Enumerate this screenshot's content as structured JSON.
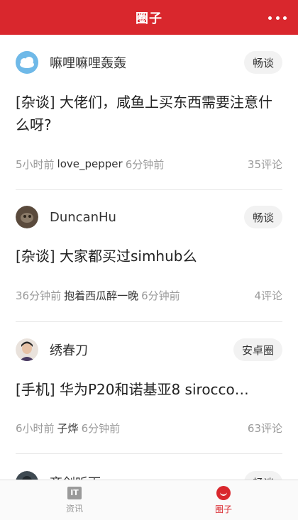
{
  "header": {
    "title": "圈子",
    "more_icon": "more-icon"
  },
  "posts": [
    {
      "author": "嘛哩嘛哩轰轰",
      "tag": "畅谈",
      "title": "[杂谈] 大佬们，咸鱼上买东西需要注意什么呀?",
      "posted": "5小时前",
      "replier": "love_pepper",
      "replied": "6分钟前",
      "comments": "35评论"
    },
    {
      "author": "DuncanHu",
      "tag": "畅谈",
      "title": "[杂谈] 大家都买过simhub么",
      "posted": "36分钟前",
      "replier": "抱着西瓜醉一晚",
      "replied": "6分钟前",
      "comments": "4评论"
    },
    {
      "author": "绣春刀",
      "tag": "安卓圈",
      "title": "[手机] 华为P20和诺基亚8 sirocco…",
      "posted": "6小时前",
      "replier": "子烨",
      "replied": "6分钟前",
      "comments": "63评论"
    },
    {
      "author": "齐剑听雨",
      "tag": "畅谈"
    }
  ],
  "tabbar": {
    "tabs": [
      {
        "label": "资讯",
        "icon": "it-icon",
        "color": "#9a9a9a"
      },
      {
        "label": "圈子",
        "icon": "circle-icon",
        "color": "#d9272d"
      }
    ]
  },
  "colors": {
    "accent": "#d9272d",
    "meta": "#9a9a9a"
  }
}
